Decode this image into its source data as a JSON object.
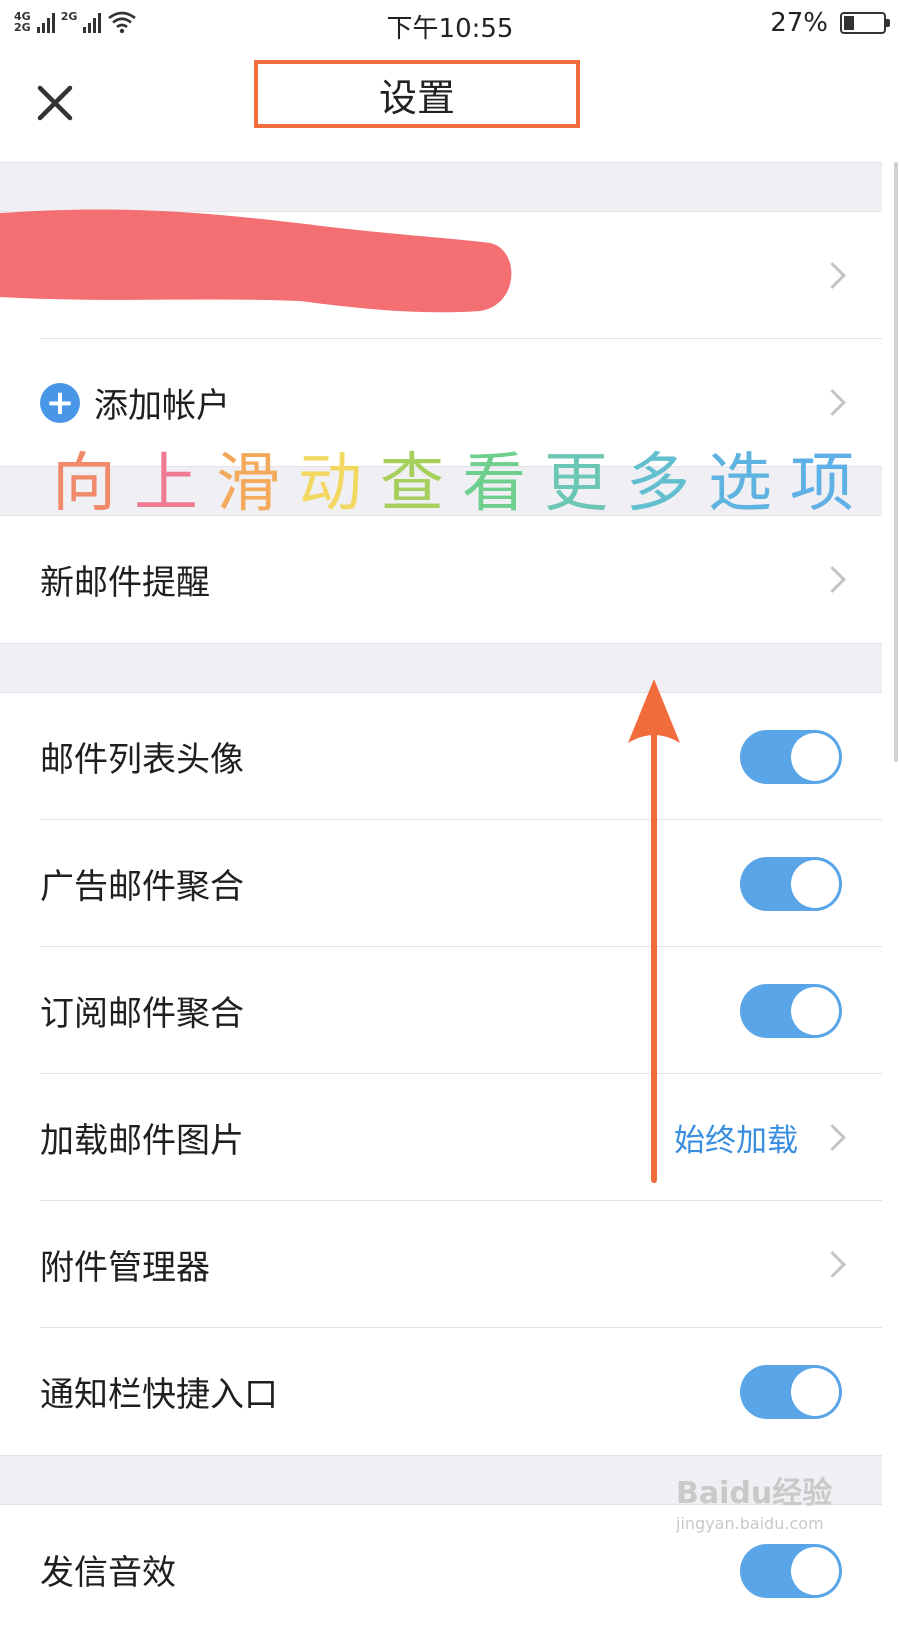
{
  "status_bar": {
    "network_top": "4G",
    "network_bottom": "2G",
    "network_second": "2G",
    "time": "下午10:55",
    "battery_percent": "27%",
    "battery_level": 0.27
  },
  "header": {
    "title": "设置",
    "title_highlight_color": "#f26b3a"
  },
  "account": {
    "add_account_label": "添加帐户"
  },
  "overlay_hint": {
    "chars": [
      "向",
      "上",
      "滑",
      "动",
      "查",
      "看",
      "更",
      "多",
      "选",
      "项"
    ],
    "colors": [
      "#f08a6a",
      "#ef7a92",
      "#f3a85a",
      "#f2d860",
      "#a6cf5c",
      "#6fcf8d",
      "#6cc6b5",
      "#62bfcf",
      "#5fb3e0",
      "#5fb0e6"
    ]
  },
  "rows": {
    "new_mail_alert": "新邮件提醒",
    "list_avatar": "邮件列表头像",
    "ad_aggregate": "广告邮件聚合",
    "subscribe_aggregate": "订阅邮件聚合",
    "load_images": "加载邮件图片",
    "load_images_value": "始终加载",
    "attachment_manager": "附件管理器",
    "notification_shortcut": "通知栏快捷入口",
    "send_sound": "发信音效"
  },
  "toggles": {
    "list_avatar": true,
    "ad_aggregate": true,
    "subscribe_aggregate": true,
    "notification_shortcut": true,
    "send_sound": true
  },
  "accent_color": "#5aa5e8",
  "watermark": {
    "main": "Baidu经验",
    "sub": "jingyan.baidu.com"
  }
}
